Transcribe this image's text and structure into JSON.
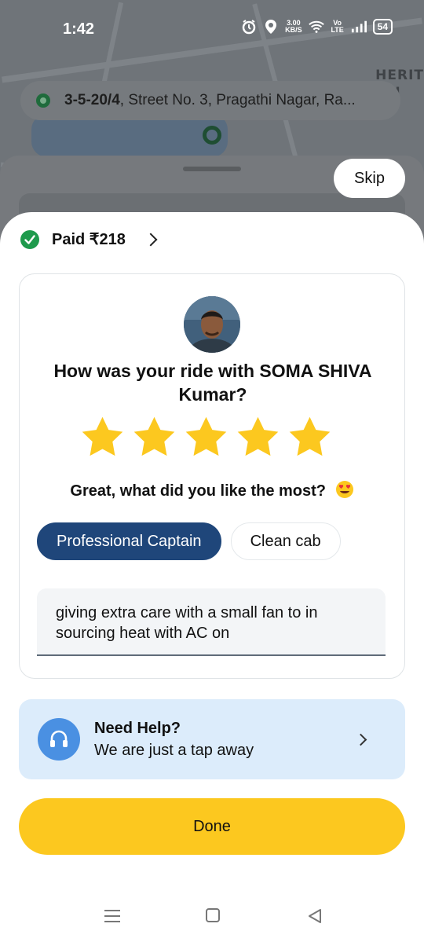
{
  "status_bar": {
    "time": "1:42",
    "net_speed_value": "3.00",
    "net_speed_unit": "KB/S",
    "volte": "Vo LTE",
    "battery": "54"
  },
  "map": {
    "address_bold": "3-5-20/4",
    "address_rest": ", Street No. 3, Pragathi Nagar, Ra...",
    "map_label_line1": "HERIT",
    "map_label_line2": "IMI"
  },
  "skip_label": "Skip",
  "payment": {
    "paid_label": "Paid ₹218",
    "status_color": "#1e9a4c"
  },
  "rating": {
    "title": "How was your ride with SOMA SHIVA Kumar?",
    "stars_selected": 5,
    "stars_total": 5,
    "star_color": "#fcc81f",
    "prompt": "Great, what did you like the most?",
    "chips": [
      {
        "label": "Professional Captain",
        "selected": true
      },
      {
        "label": "Clean cab",
        "selected": false
      }
    ],
    "feedback_text": "giving extra care with a small fan to in sourcing heat with AC on"
  },
  "help": {
    "title": "Need Help?",
    "subtitle": "We are just a tap away",
    "icon": "headset-icon"
  },
  "done_label": "Done",
  "colors": {
    "primary_button": "#fcc81f",
    "selected_chip": "#1f467a",
    "help_bg": "#dcecfb"
  }
}
